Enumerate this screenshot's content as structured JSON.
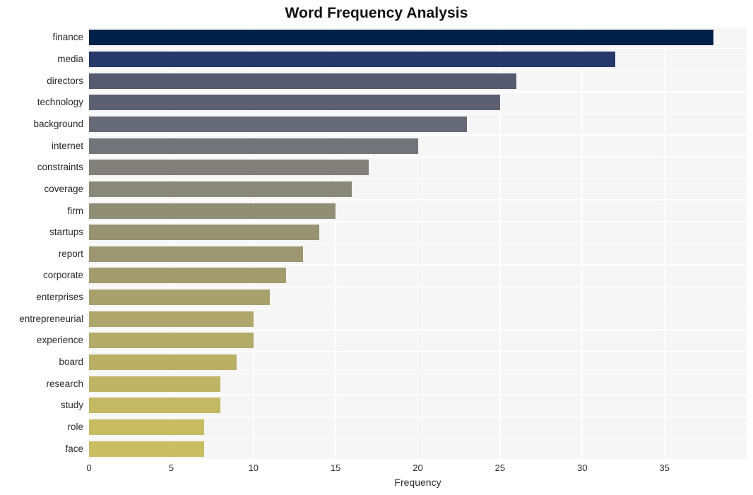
{
  "chart_data": {
    "type": "bar",
    "orientation": "horizontal",
    "title": "Word Frequency Analysis",
    "xlabel": "Frequency",
    "ylabel": "",
    "categories": [
      "finance",
      "media",
      "directors",
      "technology",
      "background",
      "internet",
      "constraints",
      "coverage",
      "firm",
      "startups",
      "report",
      "corporate",
      "enterprises",
      "entrepreneurial",
      "experience",
      "board",
      "research",
      "study",
      "role",
      "face"
    ],
    "values": [
      38,
      32,
      26,
      25,
      23,
      20,
      17,
      16,
      15,
      14,
      13,
      12,
      11,
      10,
      10,
      9,
      8,
      8,
      7,
      7
    ],
    "colors": [
      "#002147",
      "#27396b",
      "#555a70",
      "#5c6072",
      "#666a78",
      "#73747a",
      "#81807b",
      "#8a8878",
      "#918e76",
      "#979373",
      "#9c9770",
      "#a29c6e",
      "#a8a16c",
      "#aea66a",
      "#b3ab68",
      "#b9b066",
      "#beb464",
      "#c3b863",
      "#c7bc62",
      "#c9be61"
    ],
    "xlim": [
      0,
      40
    ],
    "xticks": [
      0,
      5,
      10,
      15,
      20,
      25,
      30,
      35
    ],
    "xticklabels": [
      "0",
      "5",
      "10",
      "15",
      "20",
      "25",
      "30",
      "35"
    ],
    "grid": true,
    "grid_color": "#ffffff",
    "plot_background": "#f6f6f6",
    "figure_background": "#ffffff",
    "legend": null,
    "bar_height_ratio": 0.78
  }
}
